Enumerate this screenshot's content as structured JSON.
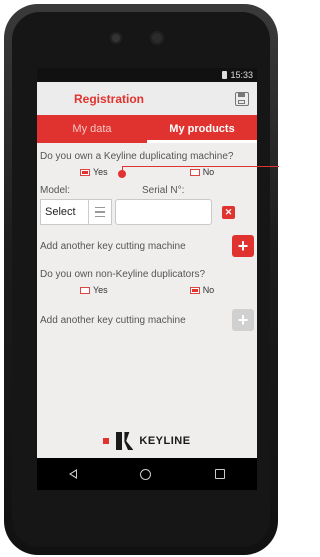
{
  "status": {
    "time": "15:33"
  },
  "appbar": {
    "title": "Registration",
    "save_icon": "save-icon"
  },
  "tabs": [
    {
      "label": "My data",
      "active": false
    },
    {
      "label": "My products",
      "active": true
    }
  ],
  "form": {
    "question_keyline": "Do you own a Keyline duplicating machine?",
    "yes_label": "Yes",
    "no_label": "No",
    "keyline_yes_checked": true,
    "keyline_no_checked": false,
    "model_label": "Model:",
    "serial_label": "Serial N°:",
    "model_select_value": "Select",
    "serial_value": "",
    "remove_icon": "close-icon",
    "add_machine_label_1": "Add another key cutting machine",
    "question_non_keyline": "Do you own non-Keyline duplicators?",
    "non_keyline_yes_checked": false,
    "non_keyline_no_checked": true,
    "add_machine_label_2": "Add another key cutting machine",
    "plus_symbol": "+"
  },
  "logo": {
    "text": "KEYLINE"
  },
  "navbar": {
    "back_icon": "back-icon",
    "home_icon": "home-icon",
    "recent_icon": "recent-apps-icon"
  },
  "colors": {
    "accent": "#e0332f",
    "background": "#efeeed",
    "disabled": "#d0d0d0"
  }
}
